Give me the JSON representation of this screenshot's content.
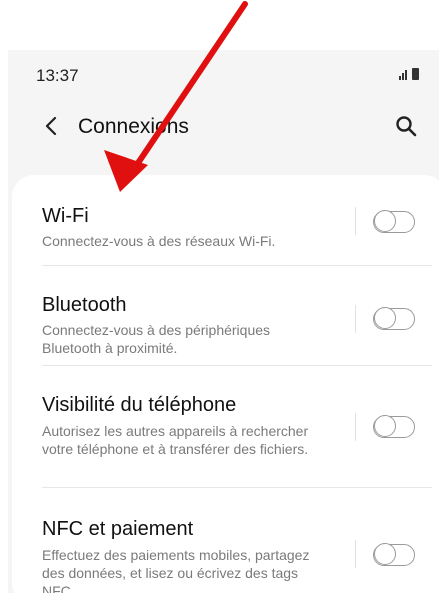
{
  "status": {
    "time": "13:37"
  },
  "header": {
    "title": "Connexions",
    "back_icon": "chevron-left-icon",
    "search_icon": "search-icon"
  },
  "settings": [
    {
      "title": "Wi-Fi",
      "description": "Connectez-vous à des réseaux Wi-Fi.",
      "enabled": false
    },
    {
      "title": "Bluetooth",
      "description": "Connectez-vous à des périphériques Bluetooth à proximité.",
      "enabled": false
    },
    {
      "title": "Visibilité du téléphone",
      "description": "Autorisez les autres appareils à rechercher votre téléphone et à transférer des fichiers.",
      "enabled": false
    },
    {
      "title": "NFC et paiement",
      "description": "Effectuez des paiements mobiles, partagez des données, et lisez ou écrivez des tags NFC.",
      "enabled": false
    }
  ],
  "annotation": {
    "color": "#e01010"
  }
}
